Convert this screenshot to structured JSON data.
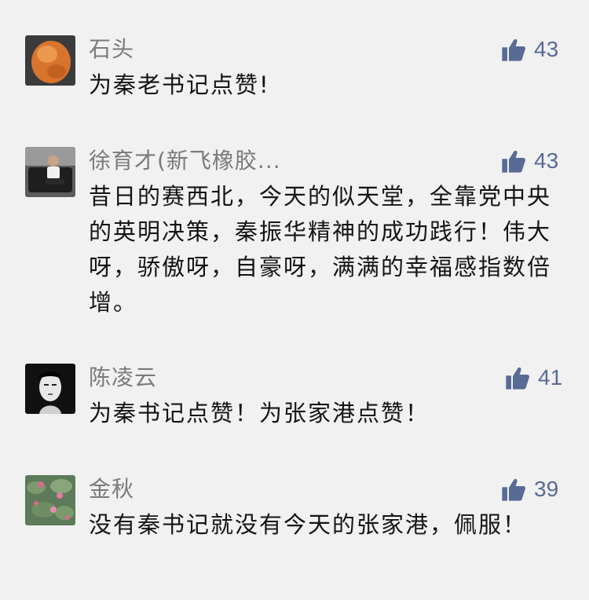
{
  "comments": [
    {
      "name": "石头",
      "text": "为秦老书记点赞!",
      "likes": "43",
      "avatar_icon": "orange-stone-photo"
    },
    {
      "name": "徐育才(新飞橡胶...",
      "text": "昔日的赛西北，今天的似天堂，全靠党中央的英明决策，秦振华精神的成功践行！伟大呀，骄傲呀，自豪呀，满满的幸福感指数倍增。",
      "likes": "43",
      "avatar_icon": "man-seated-photo"
    },
    {
      "name": "陈凌云",
      "text": "为秦书记点赞！为张家港点赞！",
      "likes": "41",
      "avatar_icon": "woman-portrait-photo"
    },
    {
      "name": "金秋",
      "text": "没有秦书记就没有今天的张家港，佩服！",
      "likes": "39",
      "avatar_icon": "water-lilies-photo"
    }
  ],
  "colors": {
    "background": "#f1f1f1",
    "name": "#7a7a7a",
    "text": "#141414",
    "like_accent": "#576b95"
  }
}
